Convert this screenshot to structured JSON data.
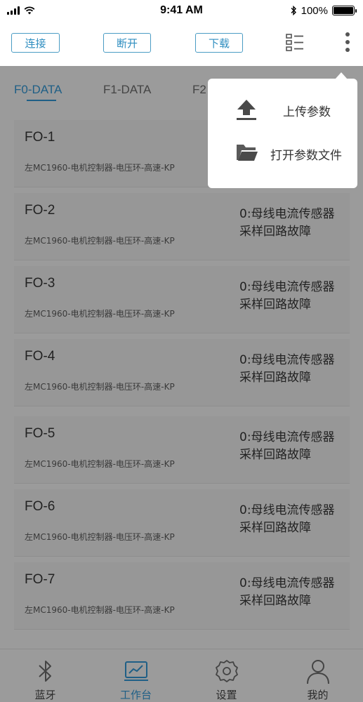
{
  "status_bar": {
    "time": "9:41 AM",
    "battery": "100%",
    "battery_level": 1.0
  },
  "toolbar": {
    "connect_label": "连接",
    "disconnect_label": "断开",
    "download_label": "下载",
    "list_icon": "list-view-icon",
    "more_icon": "more-vertical-icon",
    "accent": "#2f8ec0"
  },
  "tabs": [
    {
      "label": "F0-DATA",
      "active": true
    },
    {
      "label": "F1-DATA",
      "active": false
    },
    {
      "label": "F2",
      "active": false
    }
  ],
  "cards": [
    {
      "title": "FO-1",
      "subtitle": "左MC1960-电机控制器-电压环-高速-KP",
      "status_line1": "",
      "status_line2": ""
    },
    {
      "title": "FO-2",
      "subtitle": "左MC1960-电机控制器-电压环-高速-KP",
      "status_line1": "0:母线电流传感器",
      "status_line2": "采样回路故障"
    },
    {
      "title": "FO-3",
      "subtitle": "左MC1960-电机控制器-电压环-高速-KP",
      "status_line1": "0:母线电流传感器",
      "status_line2": "采样回路故障"
    },
    {
      "title": "FO-4",
      "subtitle": "左MC1960-电机控制器-电压环-高速-KP",
      "status_line1": "0:母线电流传感器",
      "status_line2": "采样回路故障"
    },
    {
      "title": "FO-5",
      "subtitle": "左MC1960-电机控制器-电压环-高速-KP",
      "status_line1": "0:母线电流传感器",
      "status_line2": "采样回路故障"
    },
    {
      "title": "FO-6",
      "subtitle": "左MC1960-电机控制器-电压环-高速-KP",
      "status_line1": "0:母线电流传感器",
      "status_line2": "采样回路故障"
    },
    {
      "title": "FO-7",
      "subtitle": "左MC1960-电机控制器-电压环-高速-KP",
      "status_line1": "0:母线电流传感器",
      "status_line2": "采样回路故障"
    }
  ],
  "popup_menu": {
    "items": [
      {
        "label": "上传参数",
        "icon": "upload-icon"
      },
      {
        "label": "打开参数文件",
        "icon": "folder-open-icon"
      }
    ]
  },
  "bottom_nav": {
    "items": [
      {
        "label": "蓝牙",
        "icon": "bluetooth-icon",
        "active": false
      },
      {
        "label": "工作台",
        "icon": "workbench-chart-icon",
        "active": true
      },
      {
        "label": "设置",
        "icon": "gear-icon",
        "active": false
      },
      {
        "label": "我的",
        "icon": "user-icon",
        "active": false
      }
    ]
  }
}
